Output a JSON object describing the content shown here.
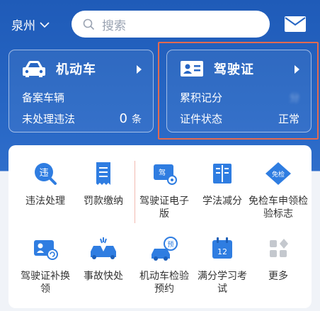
{
  "header": {
    "city": "泉州",
    "search_placeholder": "搜索"
  },
  "vehicle_card": {
    "title": "机动车",
    "rows": [
      {
        "label": "备案车辆",
        "value": ""
      },
      {
        "label": "未处理违法",
        "value": "0",
        "unit": "条"
      }
    ]
  },
  "license_card": {
    "title": "驾驶证",
    "rows": [
      {
        "label": "累积记分",
        "value": "分"
      },
      {
        "label": "证件状态",
        "value": "正常"
      }
    ]
  },
  "grid": [
    {
      "icon": "violation-icon",
      "label": "违法处理"
    },
    {
      "icon": "fine-receipt-icon",
      "label": "罚款缴纳"
    },
    {
      "icon": "e-license-icon",
      "label": "驾驶证电子版"
    },
    {
      "icon": "study-book-icon",
      "label": "学法减分"
    },
    {
      "icon": "exempt-inspection-icon",
      "label": "免检车申领检验标志"
    },
    {
      "icon": "license-reissue-icon",
      "label": "驾驶证补换领"
    },
    {
      "icon": "accident-icon",
      "label": "事故快处"
    },
    {
      "icon": "inspection-booking-icon",
      "label": "机动车检验预约"
    },
    {
      "icon": "full-score-study-icon",
      "label": "满分学习考试"
    },
    {
      "icon": "more-icon",
      "label": "更多"
    }
  ],
  "grid_badges": {
    "violation": "违",
    "e_license": "驾",
    "exempt": "免检",
    "booking": "预",
    "calendar": "12"
  },
  "colors": {
    "brand_blue": "#2766c4",
    "icon_blue": "#2f7de1",
    "highlight": "#e36a4f"
  }
}
